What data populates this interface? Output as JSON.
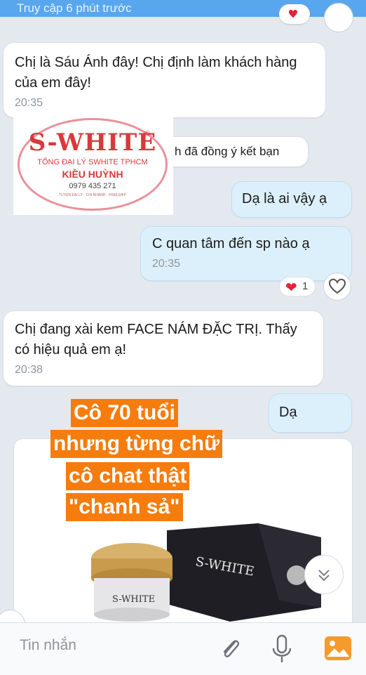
{
  "top": {
    "previous_seen": "Truy cập 6 phút trước",
    "react_count": "1"
  },
  "messages": [
    {
      "id": "m1",
      "text": "Chị là Sáu Ánh đây! Chị định làm khách hàng của em đây!",
      "time": "20:35"
    },
    {
      "id": "m2",
      "text": "h đã đồng ý kết bạn"
    },
    {
      "id": "m3",
      "text": "Dạ là ai vậy ạ"
    },
    {
      "id": "m4",
      "text": "C quan tâm đến sp nào ạ",
      "time": "20:35",
      "reaction_count": "1"
    },
    {
      "id": "m5",
      "text": "Chị đang xài kem FACE  NÁM ĐẶC TRỊ. Thấy có hiệu quả em ạ!",
      "time": "20:38"
    },
    {
      "id": "m6",
      "text": "Dạ"
    }
  ],
  "stamp": {
    "brand": "S-WHITE",
    "reg_mark": "®",
    "line1": "TỔNG ĐẠI LÝ SWHITE TPHCM",
    "name": "KIỀU HUỲNH",
    "phone": "0979 435 271",
    "tiny": "TUYỂN ĐẠI LÝ - CHI NHÁNH - FREESHIP"
  },
  "product_image": {
    "box_label": "S-WHITE",
    "jar_label": "S-WHITE"
  },
  "caption_overlay": [
    "Cô 70 tuổi",
    "nhưng từng chữ",
    "cô chat thật",
    "\"chanh sả\""
  ],
  "composer": {
    "placeholder": "Tin nhắn"
  },
  "colors": {
    "accent": "#58a6ee",
    "incoming": "#ffffff",
    "outgoing": "#dcf0fb",
    "caption": "#f57c0d",
    "heart": "#e3213a",
    "stamp": "#d8393c"
  }
}
